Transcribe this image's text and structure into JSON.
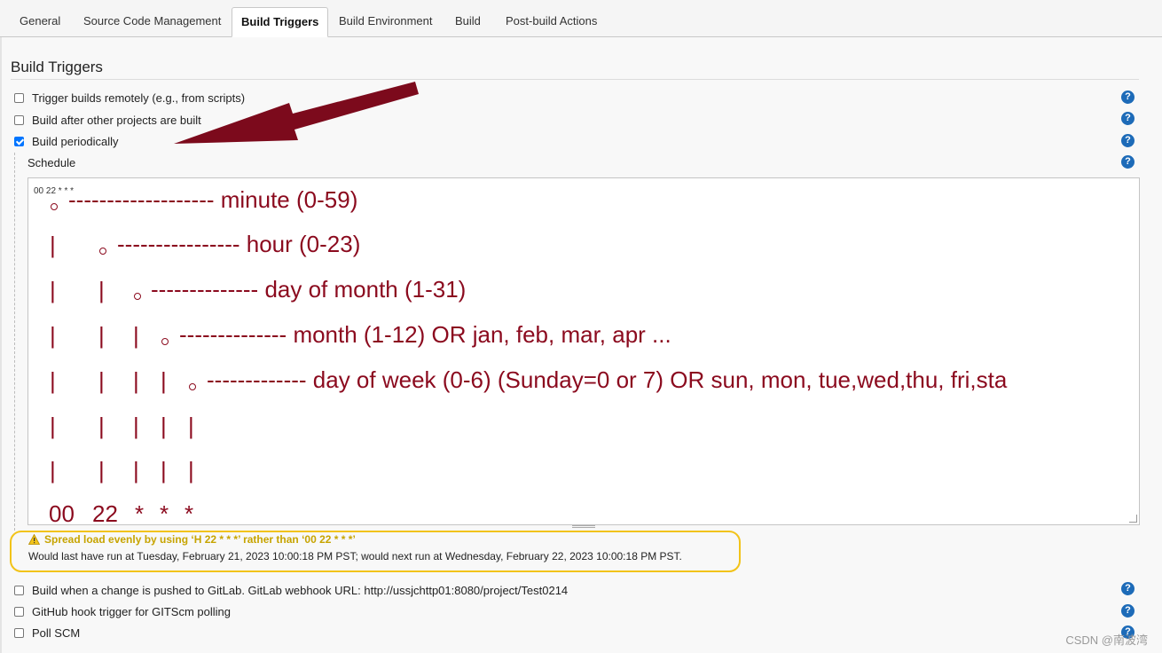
{
  "tabs": [
    {
      "label": "General",
      "active": false
    },
    {
      "label": "Source Code Management",
      "active": false
    },
    {
      "label": "Build Triggers",
      "active": true
    },
    {
      "label": "Build Environment",
      "active": false
    },
    {
      "label": "Build",
      "active": false
    },
    {
      "label": "Post-build Actions",
      "active": false
    }
  ],
  "section_title": "Build Triggers",
  "triggers_top": [
    {
      "label": "Trigger builds remotely (e.g., from scripts)",
      "checked": false
    },
    {
      "label": "Build after other projects are built",
      "checked": false
    },
    {
      "label": "Build periodically",
      "checked": true
    }
  ],
  "schedule": {
    "label": "Schedule",
    "value": "00 22 * * *"
  },
  "annotation": {
    "color": "#8b0a1e",
    "minute": "------------------- minute (0-59)",
    "hour": "---------------- hour (0-23)",
    "day_of_month": "-------------- day of month (1-31)",
    "month": "-------------- month (1-12) OR jan, feb, mar, apr ...",
    "day_of_week": "------------- day of week (0-6) (Sunday=0 or 7) OR sun, mon, tue,wed,thu, fri,sta",
    "bar": "|",
    "cron_fields": [
      "00",
      "22",
      "*",
      "*",
      "*"
    ]
  },
  "warning": "Spread load evenly by using ‘H 22 * * *’ rather than ‘00 22 * * *’",
  "run_info": "Would last have run at Tuesday, February 21, 2023 10:00:18 PM PST; would next run at Wednesday, February 22, 2023 10:00:18 PM PST.",
  "triggers_bottom": [
    {
      "label": "Build when a change is pushed to GitLab. GitLab webhook URL: http://ussjchttp01:8080/project/Test0214",
      "checked": false
    },
    {
      "label": "GitHub hook trigger for GITScm polling",
      "checked": false
    },
    {
      "label": "Poll SCM",
      "checked": false
    }
  ],
  "help_glyph": "?",
  "watermark": "CSDN @南波湾",
  "colors": {
    "help": "#1d6bb8",
    "checkbox_checked": "#0075ff",
    "warning_text": "#c7a400",
    "highlight_border": "#f2c319",
    "arrow": "#7c0a1c"
  }
}
